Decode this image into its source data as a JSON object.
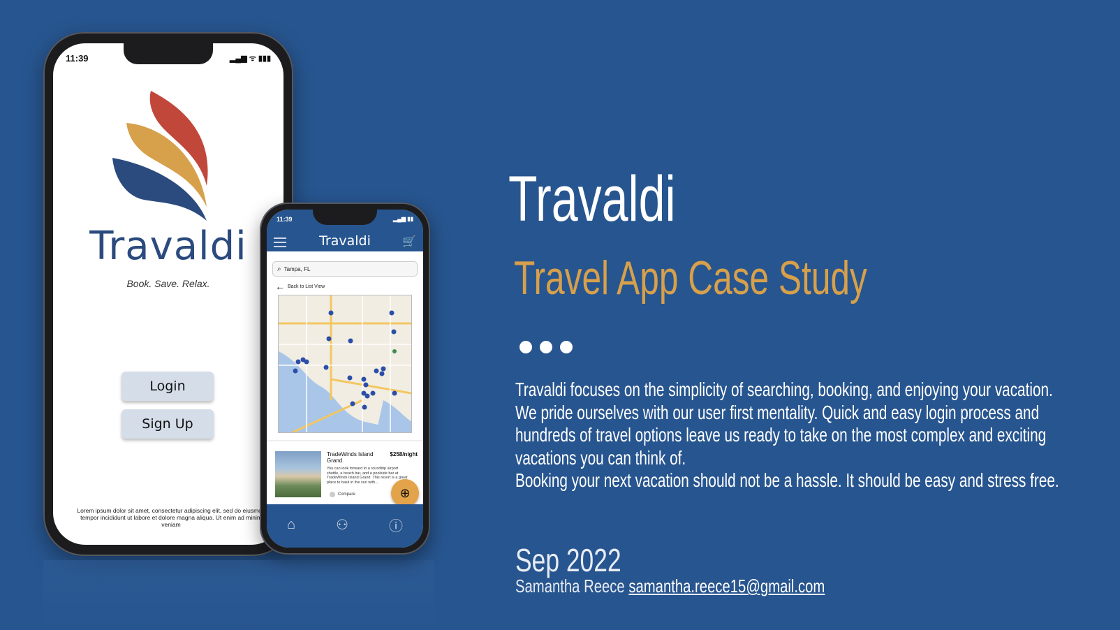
{
  "colors": {
    "background": "#27558f",
    "accent": "#d7a04b",
    "logo_red": "#c0473a",
    "logo_orange": "#d7a04b",
    "logo_blue": "#2b4a7e",
    "button_bg": "#d5dde9"
  },
  "login_phone": {
    "status_time": "11:39",
    "brand": "Travaldi",
    "tagline": "Book. Save. Relax.",
    "login_label": "Login",
    "signup_label": "Sign Up",
    "lorem": "Lorem ipsum dolor sit amet, consectetur adipiscing elit, sed do eiusmod tempor incididunt ut labore et dolore magna aliqua. Ut enim ad minim veniam"
  },
  "map_phone": {
    "status_time": "11:39",
    "app_title": "Travaldi",
    "search_value": "Tampa, FL",
    "back_label": "Back to List View",
    "hotel": {
      "name": "TradeWinds Island Grand",
      "price": "$258/night",
      "description": "You can look forward to a roundtrip airport shuttle, a beach bar, and a poolside bar at TradeWinds Island Grand. This resort is a great place to bask in the sun with...",
      "compare_label": "Compare"
    },
    "icons": {
      "menu": "hamburger-icon",
      "cart": "cart-icon",
      "search": "search-icon",
      "back": "arrow-left-icon",
      "chat": "chat-icon",
      "nav": [
        "home-icon",
        "user-icon",
        "info-icon"
      ]
    }
  },
  "content": {
    "title": "Travaldi",
    "subtitle": "Travel App Case Study",
    "description_1": "Travaldi focuses on the simplicity of searching, booking, and enjoying your vacation. We pride ourselves with our user first mentality. Quick and easy login process and hundreds of travel options leave us ready to take on the most complex and exciting vacations you can think of.",
    "description_2": "Booking your next vacation should not be a hassle. It should be easy and stress free.",
    "date": "Sep 2022",
    "author_name": "Samantha Reece",
    "author_email": "samantha.reece15@gmail.com"
  }
}
